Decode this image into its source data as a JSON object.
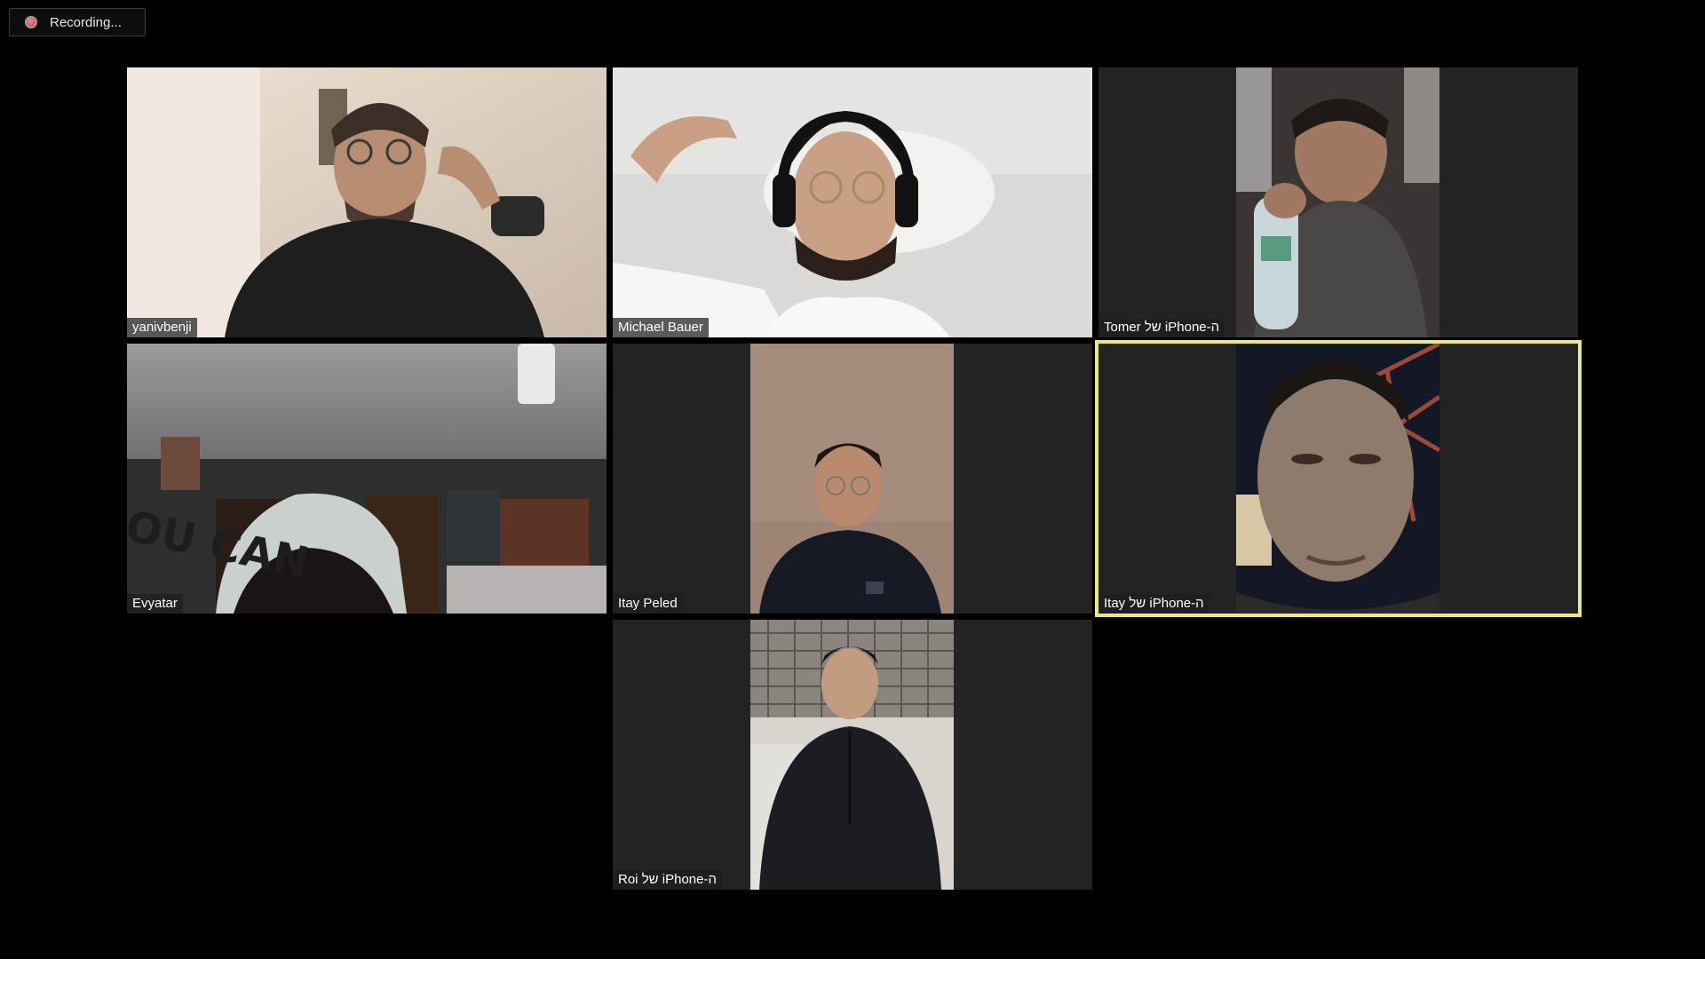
{
  "recording": {
    "label": "Recording...",
    "icon": "record-dot-icon"
  },
  "participants": [
    {
      "name": "yanivbenji",
      "video": "person wearing glasses in dark t-shirt, hand at chin, beige room"
    },
    {
      "name": "Michael Bauer",
      "video": "person with headphones lying on white pillow"
    },
    {
      "name": "Tomer של iPhone-ה",
      "video": "person in hoodie drinking from water bottle"
    },
    {
      "name": "Evyatar",
      "video": "person in white beanie, posters on wall"
    },
    {
      "name": "Itay Peled",
      "video": "person with glasses in dark hoodie, plaster wall"
    },
    {
      "name": "Itay של iPhone-ה",
      "video": "close-up of face, dark background",
      "active_speaker": true
    },
    {
      "name": "Roi של iPhone-ה",
      "video": "person in dark zip sweater under ceiling grid"
    }
  ],
  "colors": {
    "background": "#000000",
    "tile": "#232323",
    "active_border": "#eaea7c",
    "recording_dot": "#d8475a"
  }
}
